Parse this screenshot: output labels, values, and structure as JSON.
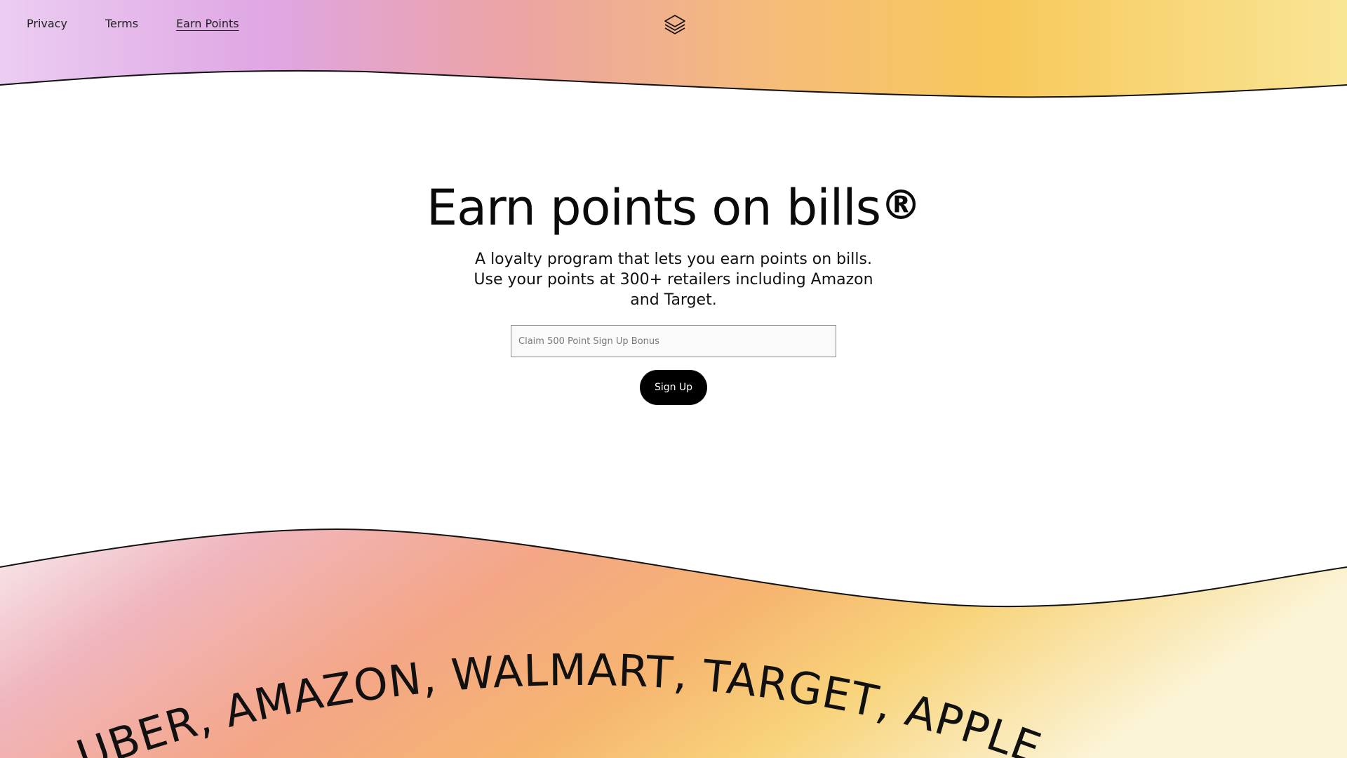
{
  "nav": {
    "items": [
      {
        "label": "Privacy",
        "active": false
      },
      {
        "label": "Terms",
        "active": false
      },
      {
        "label": "Earn Points",
        "active": true
      }
    ]
  },
  "logo": {
    "icon": "layers-stack-icon"
  },
  "hero": {
    "title": "Earn points on bills",
    "title_mark": "®",
    "subtitle": "A loyalty program that lets you earn points on bills. Use your points at 300+ retailers including Amazon and Target."
  },
  "signup": {
    "input_placeholder": "Claim 500 Point Sign Up Bonus",
    "input_value": "",
    "button_label": "Sign Up"
  },
  "retailer_marquee": {
    "text": "UBER, AMAZON, WALMART, TARGET, APPLE, "
  },
  "colors": {
    "accent": "#000000",
    "gradient_purple": "#dfa6e3",
    "gradient_pink": "#ee9fb2",
    "gradient_orange": "#f4a676",
    "gradient_yellow": "#f7c85a",
    "gradient_cream": "#faf1c8"
  }
}
